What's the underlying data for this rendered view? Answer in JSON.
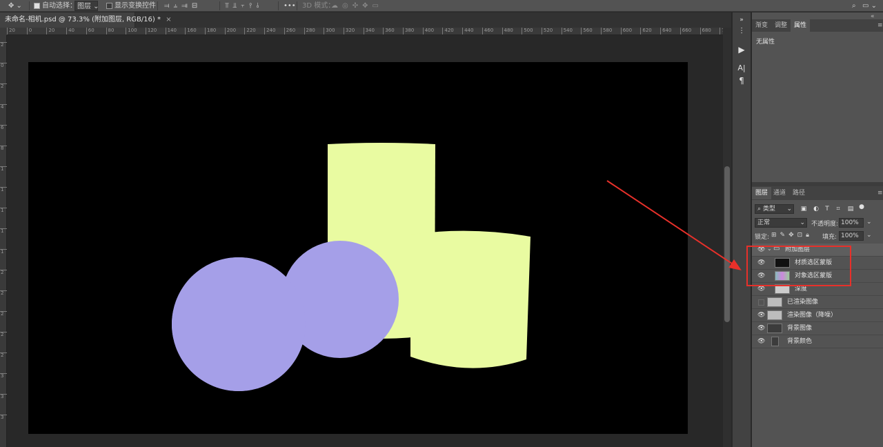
{
  "options_bar": {
    "auto_select_label": "自动选择：",
    "auto_select_target": "图层",
    "show_transform_label": "显示变换控件",
    "more_label": "•••",
    "mode_3d_label": "3D 模式："
  },
  "document_tab": {
    "title": "未命名-相机.psd @ 73.3% (附加图层, RGB/16) *",
    "close": "×"
  },
  "ruler": {
    "h_ticks": [
      "20",
      "0",
      "20",
      "40",
      "60",
      "80",
      "100",
      "120",
      "140",
      "160",
      "180",
      "200",
      "220",
      "240",
      "260",
      "280",
      "300",
      "320",
      "340",
      "360",
      "380",
      "400",
      "420",
      "440",
      "460",
      "480",
      "500",
      "520",
      "540",
      "560",
      "580",
      "600",
      "620",
      "640",
      "660",
      "680",
      "700"
    ],
    "v_ticks": [
      "2",
      "0",
      "2",
      "4",
      "6",
      "8",
      "1",
      "1",
      "1",
      "1",
      "1",
      "2",
      "2",
      "2",
      "2",
      "2",
      "3",
      "3",
      "3"
    ]
  },
  "properties_panel": {
    "tabs": [
      "渐变",
      "调整",
      "属性"
    ],
    "active_tab": "属性",
    "empty_text": "无属性"
  },
  "layers_panel": {
    "tabs": [
      "图层",
      "通道",
      "路径"
    ],
    "active_tab": "图层",
    "filter_kind": "类型",
    "blend_mode": "正常",
    "opacity_label": "不透明度:",
    "opacity_value": "100%",
    "lock_label": "锁定:",
    "fill_label": "填充:",
    "fill_value": "100%",
    "layers": [
      {
        "name": "附加图层",
        "visible": true,
        "is_group": true
      },
      {
        "name": "材质选区蒙版",
        "visible": true
      },
      {
        "name": "对象选区蒙版",
        "visible": true
      },
      {
        "name": "深度",
        "visible": true
      },
      {
        "name": "已渲染图像",
        "visible": false
      },
      {
        "name": "渲染图像（降噪）",
        "visible": true
      },
      {
        "name": "背景图像",
        "visible": true
      },
      {
        "name": "背景颜色",
        "visible": true
      }
    ]
  },
  "colors": {
    "canvas_bg": "#000000",
    "cylinder_fill": "#e9fba1",
    "sphere_fill": "#a59fe8",
    "annotation_red": "#e8302a"
  }
}
